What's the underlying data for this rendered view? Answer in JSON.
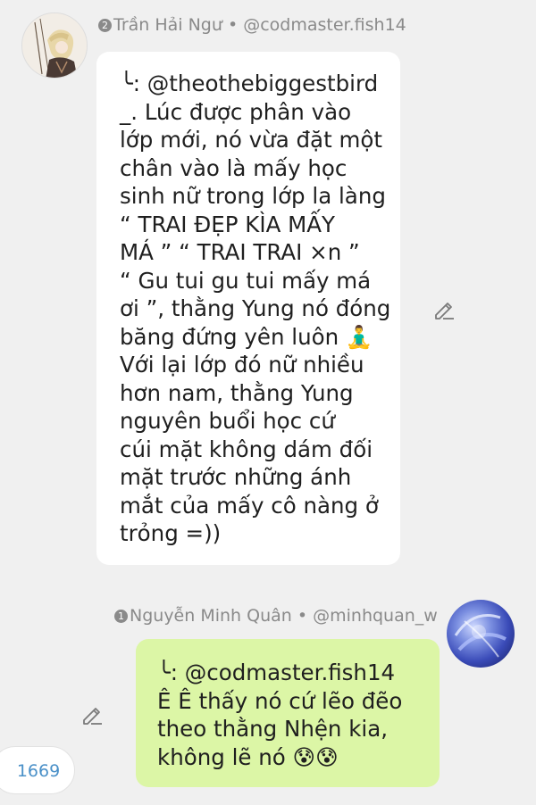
{
  "messages": [
    {
      "author_badge": "2",
      "author_name": "Trần Hải Ngư",
      "separator": "•",
      "author_handle": "@codmaster.fish14",
      "lines": [
        "╰: @theothebiggestbird",
        "_. Lúc được phân vào",
        "lớp mới, nó vừa đặt một",
        "chân vào là mấy học",
        "sinh nữ trong lớp la làng",
        "“ TRAI ĐẸP KÌA MẤY",
        "MÁ ” “ TRAI TRAI ×n ”",
        "“ Gu tui gu tui mấy má",
        "ơi ”, thằng Yung nó đóng",
        "băng đứng yên luôn 🧘‍♂️",
        "Với lại lớp đó nữ nhiều",
        "hơn nam, thằng Yung",
        "nguyên buổi học cứ",
        "cúi mặt không dám đối",
        "mặt trước những ánh",
        "mắt của mấy cô nàng ở",
        "trỏng =))"
      ]
    },
    {
      "author_badge": "1",
      "author_name": "Nguyễn Minh Quân",
      "separator": "•",
      "author_handle": "@minhquan_w",
      "lines": [
        "╰: @codmaster.fish14",
        "Ê Ê thấy nó cứ lẽo đẽo",
        "theo thằng Nhện kia,",
        "không lẽ nó 😰😰"
      ]
    }
  ],
  "counter": "1669",
  "icons": {
    "edit": "pencil-icon",
    "avatar_1": "anime-character-avatar",
    "avatar_2": "abstract-blue-avatar"
  },
  "colors": {
    "reply_bubble": "#dcf6a6",
    "counter_text": "#4a90c8"
  }
}
